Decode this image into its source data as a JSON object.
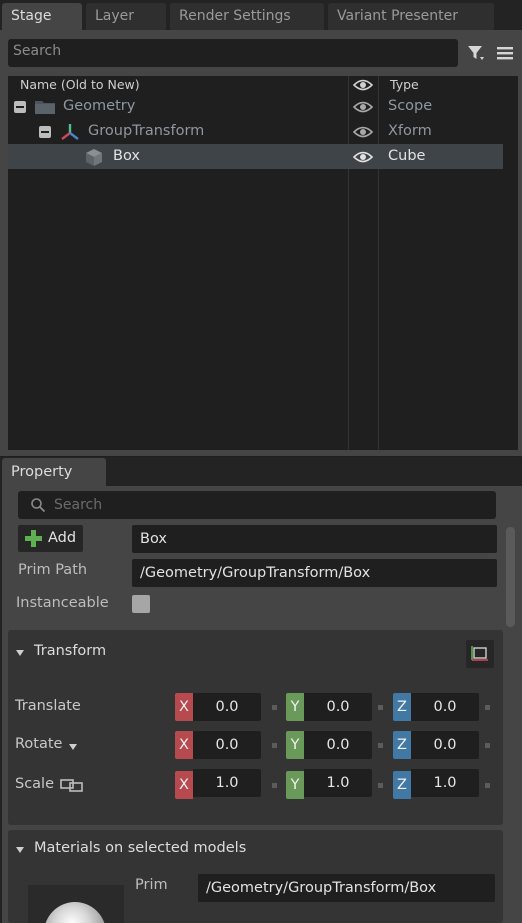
{
  "stage": {
    "tabs": [
      {
        "label": "Stage",
        "active": true
      },
      {
        "label": "Layer",
        "active": false
      },
      {
        "label": "Render Settings",
        "active": false
      },
      {
        "label": "Variant Presenter",
        "active": false
      }
    ],
    "search_placeholder": "Search",
    "columns": {
      "name": "Name (Old to New)",
      "type": "Type"
    },
    "rows": [
      {
        "name": "Geometry",
        "type": "Scope",
        "icon": "folder-icon",
        "selected": false
      },
      {
        "name": "GroupTransform",
        "type": "Xform",
        "icon": "xform-icon",
        "selected": false
      },
      {
        "name": "Box",
        "type": "Cube",
        "icon": "cube-icon",
        "selected": true
      }
    ]
  },
  "property": {
    "tab_label": "Property",
    "search_placeholder": "Search",
    "add_label": "Add",
    "prim_name": "Box",
    "prim_path_label": "Prim Path",
    "prim_path": "/Geometry/GroupTransform/Box",
    "instanceable_label": "Instanceable",
    "instanceable": false,
    "transform": {
      "title": "Transform",
      "rows": [
        {
          "label": "Translate",
          "x": "0.0",
          "y": "0.0",
          "z": "0.0"
        },
        {
          "label": "Rotate",
          "x": "0.0",
          "y": "0.0",
          "z": "0.0"
        },
        {
          "label": "Scale",
          "x": "1.0",
          "y": "1.0",
          "z": "1.0"
        }
      ]
    },
    "materials": {
      "title": "Materials on selected models",
      "prim_label": "Prim",
      "prim_value": "/Geometry/GroupTransform/Box"
    }
  },
  "colors": {
    "axis_x": "#b64a4f",
    "axis_y": "#6a9a5a",
    "axis_z": "#4279a4",
    "add_green": "#5fae52"
  }
}
